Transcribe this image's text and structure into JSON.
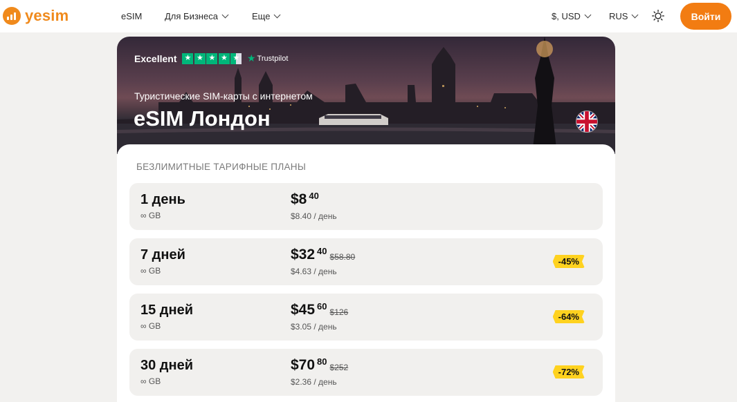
{
  "header": {
    "logo_text": "yesim",
    "nav": [
      {
        "label": "eSIM"
      },
      {
        "label": "Для Бизнеса"
      },
      {
        "label": "Еще"
      }
    ],
    "currency": "$, USD",
    "language": "RUS",
    "theme_icon": "sun-icon",
    "login_label": "Войти",
    "accent_color": "#f27c12"
  },
  "hero": {
    "trustpilot_rating_word": "Excellent",
    "trustpilot_brand": "Trustpilot",
    "rating_stars": 4.5,
    "subtitle": "Туристические SIM-карты с интернетом",
    "title": "eSIM Лондон",
    "flag_icon": "uk-flag-icon"
  },
  "plans_section": {
    "title": "БЕЗЛИМИТНЫЕ ТАРИФНЫЕ ПЛАНЫ",
    "plans": [
      {
        "name": "1 день",
        "data": "∞ GB",
        "price_main": "$8",
        "price_cents": "40",
        "old_price": "",
        "per_day": "$8.40 / день",
        "discount": ""
      },
      {
        "name": "7 дней",
        "data": "∞ GB",
        "price_main": "$32",
        "price_cents": "40",
        "old_price": "$58.80",
        "per_day": "$4.63 / день",
        "discount": "-45%"
      },
      {
        "name": "15 дней",
        "data": "∞ GB",
        "price_main": "$45",
        "price_cents": "60",
        "old_price": "$126",
        "per_day": "$3.05 / день",
        "discount": "-64%"
      },
      {
        "name": "30 дней",
        "data": "∞ GB",
        "price_main": "$70",
        "price_cents": "80",
        "old_price": "$252",
        "per_day": "$2.36 / день",
        "discount": "-72%"
      }
    ],
    "badge_color": "#ffd21f"
  }
}
